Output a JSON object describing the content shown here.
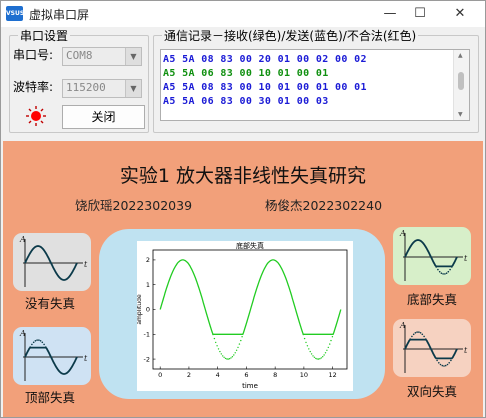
{
  "window": {
    "title": "虚拟串口屏",
    "app_icon_text": "VSUS",
    "min_glyph": "—",
    "max_glyph": "☐",
    "close_glyph": "✕"
  },
  "serial": {
    "group_title": "串口设置",
    "port_label": "串口号:",
    "port_value": "COM8",
    "baud_label": "波特率:",
    "baud_value": "115200",
    "close_button": "关闭",
    "status_color": "#ff0000"
  },
  "log": {
    "group_title": "通信记录－接收(绿色)/发送(蓝色)/不合法(红色)",
    "lines": [
      {
        "text": "A5 5A 08 83 00 20 01 00 02 00 02",
        "color": "#1b1bd6"
      },
      {
        "text": "A5 5A 06 83 00 10 01 00 01",
        "color": "#109010"
      },
      {
        "text": "A5 5A 08 83 00 10 01 00 01 00 01",
        "color": "#1b1bd6"
      },
      {
        "text": "A5 5A 06 83 00 30 01 00 03",
        "color": "#1b1bd6"
      }
    ]
  },
  "screen": {
    "heading": "实验1 放大器非线性失真研究",
    "student_left": "饶欣瑶2022302039",
    "student_right": "杨俊杰2022302240",
    "cards": {
      "none": {
        "label": "没有失真",
        "bg": "#e0e0e0",
        "line": "#0b3a4a"
      },
      "top": {
        "label": "顶部失真",
        "bg": "#cfe2f3",
        "line": "#0b3a4a"
      },
      "bottom": {
        "label": "底部失真",
        "bg": "#d7efc9",
        "line": "#0b3a4a"
      },
      "both": {
        "label": "双向失真",
        "bg": "#f6d2c1",
        "line": "#0b3a4a"
      }
    },
    "axis_letters": {
      "y": "A",
      "x": "t"
    }
  },
  "chart_data": {
    "type": "line",
    "title": "底部失真",
    "xlabel": "time",
    "ylabel": "amplitude",
    "xlim": [
      -0.5,
      13
    ],
    "ylim": [
      -2.4,
      2.4
    ],
    "xticks": [
      0,
      2,
      4,
      6,
      8,
      10,
      12
    ],
    "yticks": [
      -2,
      -1,
      0,
      1,
      2
    ],
    "grid": false,
    "series": [
      {
        "style": "solid",
        "color": "#22cc22",
        "function": "2*sin(t) clipped below at -1",
        "x_range": [
          0,
          12.566
        ]
      },
      {
        "style": "dotted",
        "color": "#22cc22",
        "function": "2*sin(t) where below -1",
        "x_range": [
          0,
          12.566
        ]
      }
    ]
  }
}
